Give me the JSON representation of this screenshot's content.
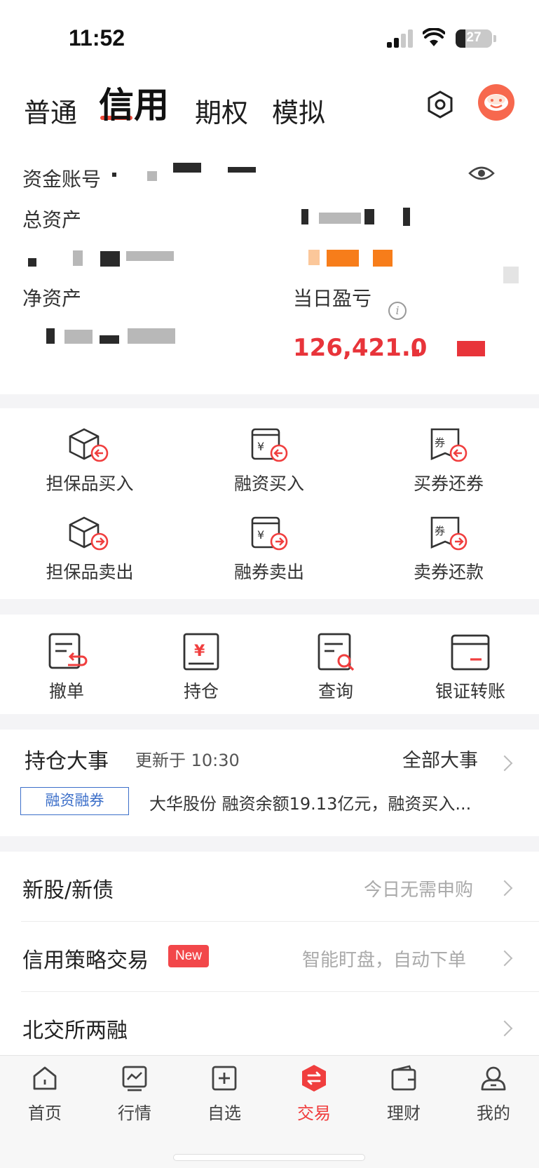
{
  "status_bar": {
    "time": "11:52",
    "battery": "27",
    "battery_level": 0.27
  },
  "header": {
    "tabs": [
      {
        "label": "普通"
      },
      {
        "label": "信用"
      },
      {
        "label": "期权"
      },
      {
        "label": "模拟"
      }
    ],
    "active_tab": "信用",
    "settings_icon": "hexagon-settings-icon",
    "avatar_icon": "cartoon-avatar"
  },
  "account": {
    "account_label": "资金账号",
    "total_assets_label": "总资产",
    "net_assets_label": "净资产",
    "daily_pnl_label": "当日盈亏",
    "daily_pnl_value": "126,421.0",
    "eye_icon": "eye-icon",
    "info_icon": "info-icon",
    "info_glyph": "i"
  },
  "trade_grid": [
    {
      "label": "担保品买入",
      "icon": "box-buy-icon"
    },
    {
      "label": "融资买入",
      "icon": "yuan-buy-icon"
    },
    {
      "label": "买券还券",
      "icon": "coupon-buy-icon"
    },
    {
      "label": "担保品卖出",
      "icon": "box-sell-icon"
    },
    {
      "label": "融券卖出",
      "icon": "yuan-sell-icon"
    },
    {
      "label": "卖券还款",
      "icon": "coupon-sell-icon"
    }
  ],
  "tools": [
    {
      "label": "撤单",
      "icon": "cancel-order-icon"
    },
    {
      "label": "持仓",
      "icon": "position-icon"
    },
    {
      "label": "查询",
      "icon": "query-icon"
    },
    {
      "label": "银证转账",
      "icon": "transfer-card-icon"
    }
  ],
  "events": {
    "title": "持仓大事",
    "update": "更新于 10:30",
    "all_label": "全部大事",
    "tag": "融资融券",
    "text": "大华股份 融资余额19.13亿元，融资买入..."
  },
  "list": [
    {
      "title": "新股/新债",
      "right": "今日无需申购"
    },
    {
      "title": "信用策略交易",
      "badge": "New",
      "right": "智能盯盘，自动下单"
    },
    {
      "title": "北交所两融",
      "right": ""
    }
  ],
  "tabbar": [
    {
      "label": "首页",
      "icon": "home-icon"
    },
    {
      "label": "行情",
      "icon": "market-chart-icon"
    },
    {
      "label": "自选",
      "icon": "add-watchlist-icon"
    },
    {
      "label": "交易",
      "icon": "trade-exchange-icon"
    },
    {
      "label": "理财",
      "icon": "wallet-icon"
    },
    {
      "label": "我的",
      "icon": "user-profile-icon"
    }
  ],
  "active_nav": "交易",
  "colors": {
    "accent": "#f03e3e",
    "tag_blue": "#3c6fc9",
    "pnl_red": "#e8343a"
  }
}
